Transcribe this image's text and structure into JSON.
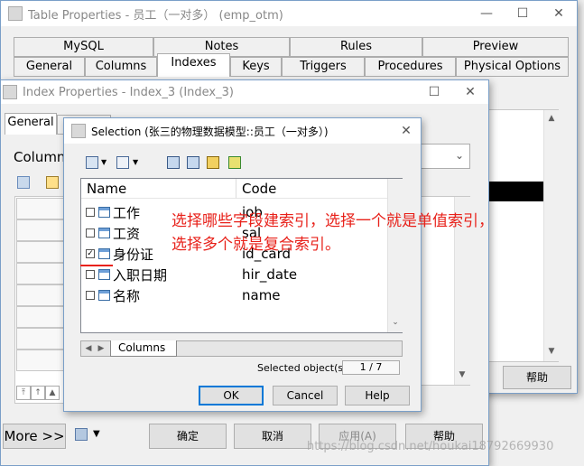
{
  "table_window": {
    "title": "Table Properties - 员工（一对多） (emp_otm)",
    "tabs_row1": [
      "MySQL",
      "Notes",
      "Rules",
      "Preview"
    ],
    "tabs_row2": [
      "General",
      "Columns",
      "Indexes",
      "Keys",
      "Triggers",
      "Procedures",
      "Physical Options"
    ],
    "help_label": "帮助"
  },
  "index_window": {
    "title": "Index Properties - Index_3 (Index_3)",
    "tab_general": "General",
    "tab_columns": "Co",
    "columns_label": "Columns",
    "more_label": "More >>",
    "ok_label": "确定",
    "cancel_label": "取消",
    "apply_label": "应用(A)",
    "help_label": "帮助"
  },
  "selection_dialog": {
    "title": "Selection (张三的物理数据模型::员工（一对多）)",
    "col_name": "Name",
    "col_code": "Code",
    "rows": [
      {
        "name": "工作",
        "code": "job",
        "checked": false
      },
      {
        "name": "工资",
        "code": "sal",
        "checked": false
      },
      {
        "name": "身份证",
        "code": "id_card",
        "checked": true
      },
      {
        "name": "入职日期",
        "code": "hir_date",
        "checked": false
      },
      {
        "name": "名称",
        "code": "name",
        "checked": false
      }
    ],
    "bottom_tab": "Columns",
    "selected_label": "Selected object(s):",
    "selected_count": "1 / 7",
    "ok_label": "OK",
    "cancel_label": "Cancel",
    "help_label": "Help"
  },
  "annotation": {
    "line1": "选择哪些字段建索引，选择一个就是单值索引，",
    "line2": "选择多个就是复合索引。",
    "color": "#e8211a"
  },
  "watermark": "https://blog.csdn.net/houkai18792669930"
}
